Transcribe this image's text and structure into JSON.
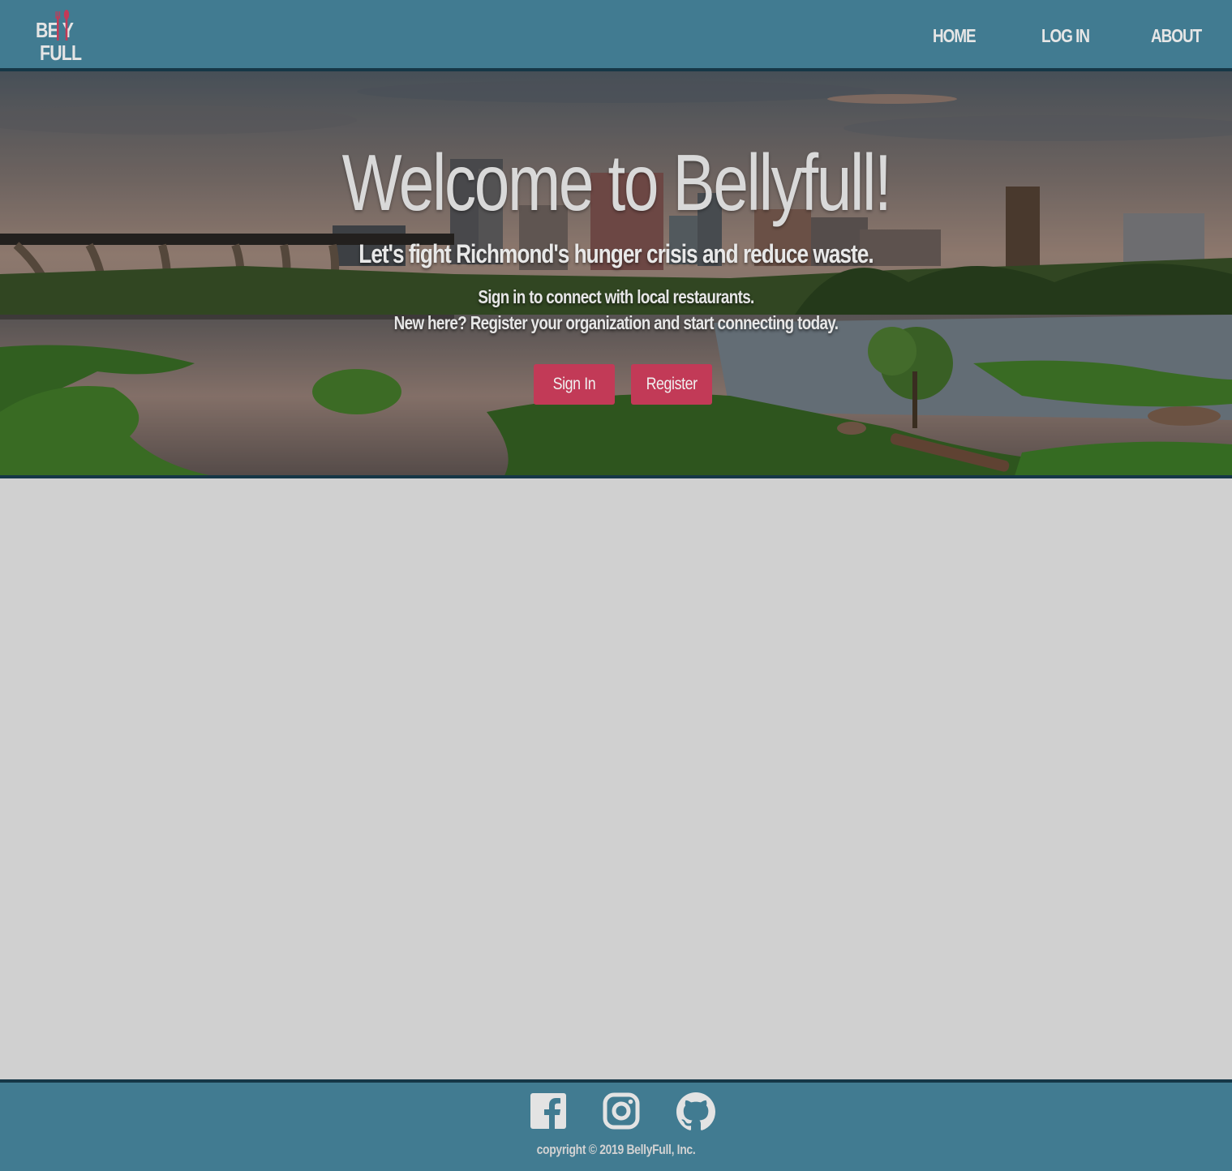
{
  "brand": {
    "logo_line1": "BE  Y",
    "logo_line2": "FULL"
  },
  "nav": {
    "items": [
      {
        "label": "HOME"
      },
      {
        "label": "LOG IN"
      },
      {
        "label": "ABOUT"
      }
    ]
  },
  "hero": {
    "title": "Welcome to Bellyfull!",
    "subtitle": "Let's fight Richmond's hunger crisis and reduce waste.",
    "line1": "Sign in to connect with local restaurants.",
    "line2": "New here? Register your organization and start connecting today.",
    "sign_in_label": "Sign In",
    "register_label": "Register"
  },
  "footer": {
    "social": [
      "facebook-icon",
      "instagram-icon",
      "github-icon"
    ],
    "copyright": "copyright © 2019 BellyFull, Inc."
  },
  "colors": {
    "nav_bg": "#417b91",
    "border": "#163747",
    "accent": "#c23a57",
    "page_bg": "#d0d0d0"
  }
}
